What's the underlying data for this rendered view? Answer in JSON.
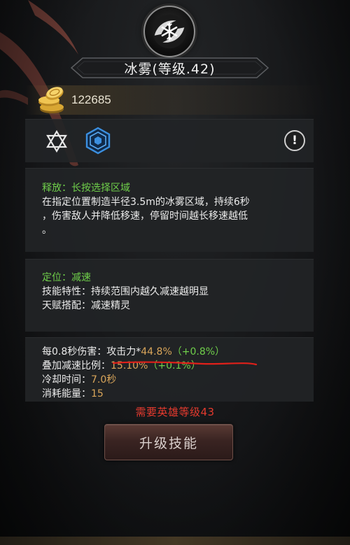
{
  "skill": {
    "icon": "snowflake-icon",
    "title": "冰雾(等级.42)"
  },
  "currency": {
    "icon": "gold-coins-icon",
    "amount": "122685"
  },
  "attributes": {
    "icons": [
      "star-of-david-icon",
      "blue-hexagon-rune-icon"
    ],
    "info_label": "!"
  },
  "release": {
    "heading": "释放：长按选择区域",
    "lines": [
      "在指定位置制造半径3.5m的冰雾区域，持续6秒",
      "，伤害敌人并降低移速，停留时间越长移速越低",
      "。"
    ]
  },
  "position": {
    "heading": "定位：减速",
    "trait": "技能特性：持续范围内越久减速越明显",
    "talent": "天赋搭配：减速精灵"
  },
  "stats": {
    "damage_label": "每0.8秒伤害：",
    "damage_base": "攻击力*",
    "damage_value": "44.8%",
    "damage_bonus": "（+0.8%）",
    "slow_label": "叠加减速比例：",
    "slow_value": "15.10%",
    "slow_bonus": "（+0.1%）",
    "cooldown_label": "冷却时间：",
    "cooldown_value": "7.0秒",
    "cost_label": "消耗能量：",
    "cost_value": "15"
  },
  "requirement": "需要英雄等级43",
  "upgrade_button": "升级技能",
  "colors": {
    "green": "#6fcf4a",
    "orange": "#d9a55a",
    "red": "#e43a2e",
    "hex_blue": "#3b8fe0"
  }
}
